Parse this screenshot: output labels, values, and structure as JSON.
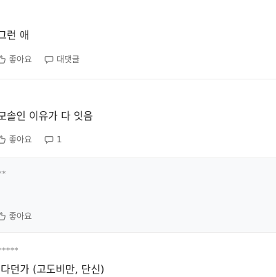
{
  "comments": [
    {
      "text": "그런 애",
      "like_label": "좋아요",
      "reply_label": "대댓글"
    },
    {
      "text": "모솔인 이유가 다 잇음",
      "like_label": "좋아요",
      "reply_count": "1"
    },
    {
      "author": "**",
      "like_label": "좋아요"
    },
    {
      "author": "*****",
      "text": "|다던가 (고도비만, 단신)"
    }
  ]
}
